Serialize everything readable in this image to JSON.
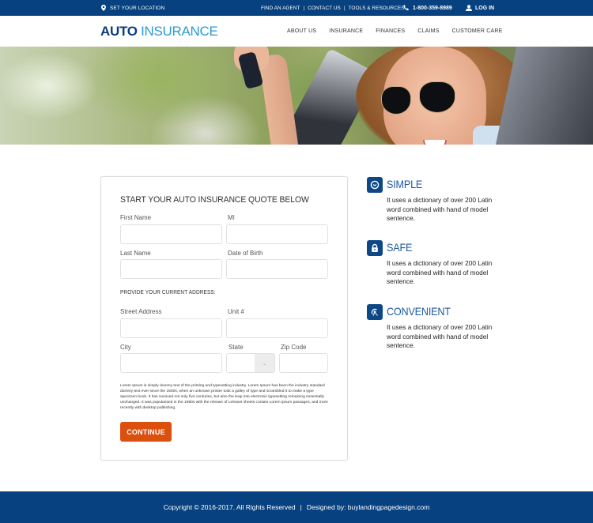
{
  "topbar": {
    "location_label": "SET YOUR LOCATION",
    "location_icon": "map-pin-icon",
    "links": [
      "FIND AN AGENT",
      "CONTACT US",
      "TOOLS & RESOURCES"
    ],
    "separator": "|",
    "phone": "1-800-359-8989",
    "phone_icon": "phone-icon",
    "login_label": "LOG IN",
    "login_icon": "user-icon"
  },
  "header": {
    "logo_bold": "AUTO",
    "logo_light": "INSURANCE",
    "nav": [
      "ABOUT US",
      "INSURANCE",
      "FINANCES",
      "CLAIMS",
      "CUSTOMER CARE"
    ]
  },
  "hero": {
    "image_description": "smiling woman in sunglasses holding car key, leaning out of car window"
  },
  "form": {
    "title": "START YOUR AUTO INSURANCE QUOTE BELOW",
    "fields": {
      "first_name": {
        "label": "First Name",
        "value": ""
      },
      "mi": {
        "label": "MI",
        "value": ""
      },
      "last_name": {
        "label": "Last Name",
        "value": ""
      },
      "dob": {
        "label": "Date of Birth",
        "value": ""
      },
      "street": {
        "label": "Street Address",
        "value": ""
      },
      "unit": {
        "label": "Unit #",
        "value": ""
      },
      "city": {
        "label": "City",
        "value": ""
      },
      "state": {
        "label": "State",
        "value": ""
      },
      "zip": {
        "label": "Zip Code",
        "value": ""
      }
    },
    "address_section": "PROVIDE YOUR CURRENT ADDRESS:",
    "disclaimer": "Lorem Ipsum is simply dummy text of the printing and typesetting industry. Lorem Ipsum has been the industry standard dummy text ever since the 1500s, when an unknown printer took a galley of type and scrambled it to make a type specimen book. It has survived not only five centuries, but also the leap into electronic typesetting remaining essentially unchanged. It was popularised in the 1960s with the release of Letraset sheets contain Lorem Ipsum passages, and more recently with desktop publishing.",
    "submit_label": "CONTINUE"
  },
  "features": [
    {
      "title": "SIMPLE",
      "icon": "clock-icon",
      "desc": "It uses a dictionary of over 200 Latin word combined with hand of model sentence."
    },
    {
      "title": "SAFE",
      "icon": "lock-icon",
      "desc": "It uses a dictionary of over 200 Latin word combined with hand of model sentence."
    },
    {
      "title": "CONVENIENT",
      "icon": "satellite-icon",
      "desc": "It uses a dictionary of over 200 Latin word combined with hand of model sentence."
    }
  ],
  "colors": {
    "brand_navy": "#07417f",
    "accent_blue": "#2a9ad6",
    "button_orange": "#db4f0f"
  },
  "footer": {
    "copyright": "Copyright © 2016-2017. All Rights Reserved",
    "separator": "|",
    "designed_by": "Designed by: buylandingpagedesign.com"
  }
}
